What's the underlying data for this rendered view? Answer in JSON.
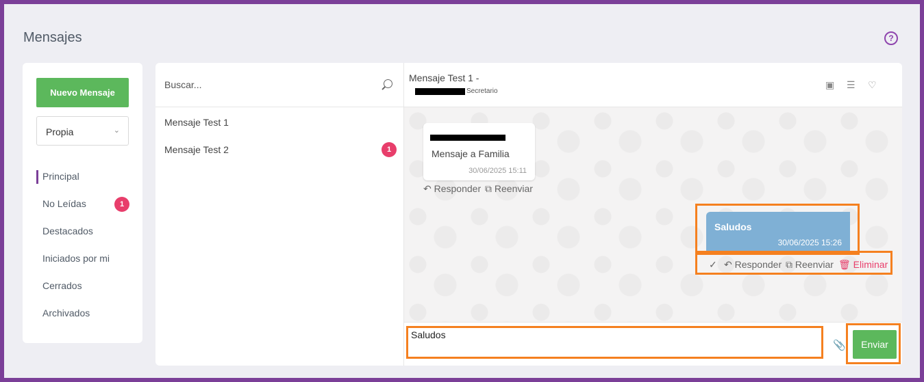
{
  "page": {
    "title": "Mensajes"
  },
  "left_nav": {
    "new_message_label": "Nuevo Mensaje",
    "filter_selected": "Propia",
    "items": [
      {
        "label": "Principal",
        "active": true
      },
      {
        "label": "No Leídas",
        "badge": "1"
      },
      {
        "label": "Destacados"
      },
      {
        "label": "Iniciados por mi"
      },
      {
        "label": "Cerrados"
      },
      {
        "label": "Archivados"
      }
    ]
  },
  "message_list": {
    "search_placeholder": "Buscar...",
    "items": [
      {
        "title": "Mensaje Test 1"
      },
      {
        "title": "Mensaje Test 2",
        "badge": "1"
      }
    ]
  },
  "conversation": {
    "title": "Mensaje Test 1 -",
    "sender_role": "Secretario",
    "messages": [
      {
        "direction": "incoming",
        "text": "Mensaje a Familia",
        "time": "30/06/2025 15:11",
        "actions": {
          "reply": "Responder",
          "forward": "Reenviar"
        }
      },
      {
        "direction": "outgoing",
        "text": "Saludos",
        "time": "30/06/2025 15:26",
        "actions": {
          "check": "✓",
          "reply": "Responder",
          "forward": "Reenviar",
          "delete": "Eliminar"
        }
      }
    ],
    "composer": {
      "value": "Saludos",
      "send_label": "Enviar"
    }
  },
  "colors": {
    "accent": "#7b3f98",
    "primary_button": "#5cb85c",
    "badge": "#e83e6b",
    "outgoing_bubble": "#7fb0d5",
    "highlight": "#f5801f"
  },
  "icons": [
    "help-icon",
    "search-icon",
    "archive-icon",
    "list-icon",
    "heart-icon",
    "reply-icon",
    "forward-icon",
    "trash-icon",
    "paperclip-icon",
    "chevron-down-icon"
  ]
}
